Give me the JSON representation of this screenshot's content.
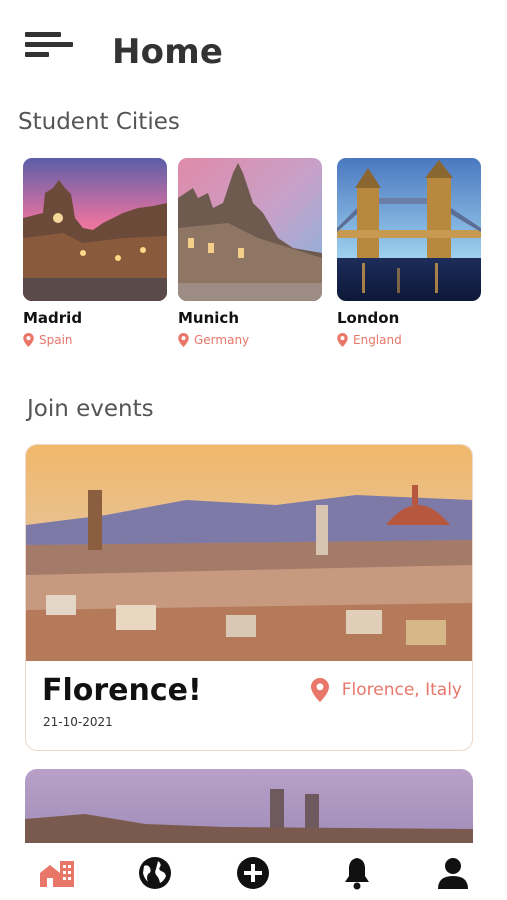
{
  "header": {
    "title": "Home",
    "menu_icon": "menu-icon"
  },
  "student_cities": {
    "title": "Student Cities",
    "items": [
      {
        "name": "Madrid",
        "country": "Spain"
      },
      {
        "name": "Munich",
        "country": "Germany"
      },
      {
        "name": "London",
        "country": "England"
      }
    ]
  },
  "events": {
    "title": "Join events",
    "items": [
      {
        "title": "Florence!",
        "date": "21-10-2021",
        "location": "Florence, Italy"
      }
    ]
  },
  "colors": {
    "accent": "#e8776a",
    "active_nav": "#e8776a",
    "nav_icon": "#111111"
  },
  "bottom_nav": [
    {
      "icon": "city-home-icon",
      "active": true
    },
    {
      "icon": "globe-icon",
      "active": false
    },
    {
      "icon": "add-icon",
      "active": false
    },
    {
      "icon": "bell-icon",
      "active": false
    },
    {
      "icon": "profile-icon",
      "active": false
    }
  ]
}
